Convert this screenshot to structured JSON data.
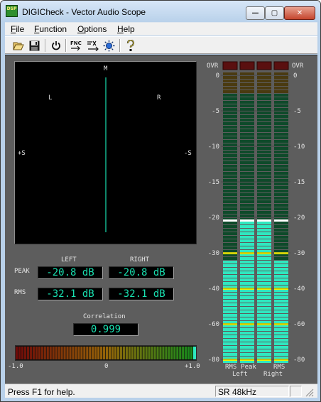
{
  "window": {
    "title": "DIGICheck - Vector Audio Scope",
    "app_icon_text": "DSP",
    "minimize_symbol": "—",
    "maximize_symbol": "▢",
    "close_symbol": "✕"
  },
  "menu": [
    {
      "label": "File",
      "accel": "F",
      "rest": "ile"
    },
    {
      "label": "Function",
      "accel": "F",
      "rest": "unction"
    },
    {
      "label": "Options",
      "accel": "O",
      "rest": "ptions"
    },
    {
      "label": "Help",
      "accel": "H",
      "rest": "elp"
    }
  ],
  "toolbar": [
    {
      "name": "open-icon"
    },
    {
      "name": "save-icon"
    },
    {
      "name": "power-icon"
    },
    {
      "name": "function-icon"
    },
    {
      "name": "options-icon"
    },
    {
      "name": "display-icon"
    },
    {
      "name": "help-icon"
    }
  ],
  "toolbar_labels": {
    "fnc": "FNC"
  },
  "scope": {
    "label_m": "M",
    "label_l": "L",
    "label_r": "R",
    "label_plus_s": "+S",
    "label_minus_s": "-S",
    "trace_color": "#19e0b0"
  },
  "levels": {
    "left_header": "LEFT",
    "right_header": "RIGHT",
    "peak_label": "PEAK",
    "rms_label": "RMS",
    "peak_left": "-20.8 dB",
    "peak_right": "-20.8 dB",
    "rms_left": "-32.1 dB",
    "rms_right": "-32.1 dB"
  },
  "correlation": {
    "label": "Correlation",
    "value": "0.999",
    "value_num": 0.999,
    "tick_min": "-1.0",
    "tick_mid": "0",
    "tick_max": "+1.0"
  },
  "meters": {
    "scale_left": [
      "0",
      "-5",
      "-10",
      "-15",
      "-20",
      "-30",
      "-40",
      "-60",
      "-80"
    ],
    "scale_right": [
      "0",
      "-5",
      "-10",
      "-15",
      "-20",
      "-30",
      "-40",
      "-60",
      "-80"
    ],
    "ovr_left": "OVR",
    "ovr_right": "OVR",
    "bottom_row1": [
      "RMS",
      "Peak",
      "RMS"
    ],
    "bottom_row2": [
      "Left",
      "Right"
    ],
    "bars": [
      {
        "kind": "RMS",
        "channel": "Left",
        "level_db": -32.1
      },
      {
        "kind": "Peak",
        "channel": "Left",
        "level_db": -20.8
      },
      {
        "kind": "Peak",
        "channel": "Right",
        "level_db": -20.8
      },
      {
        "kind": "RMS",
        "channel": "Right",
        "level_db": -32.1
      }
    ],
    "peak_hold_db": -20.8,
    "lit_color": "#2fe8c0",
    "dark_color": "#0e4a2a",
    "marker_color": "#f0f000"
  },
  "status": {
    "help": "Press F1 for help.",
    "sample_rate": "SR 48kHz"
  }
}
